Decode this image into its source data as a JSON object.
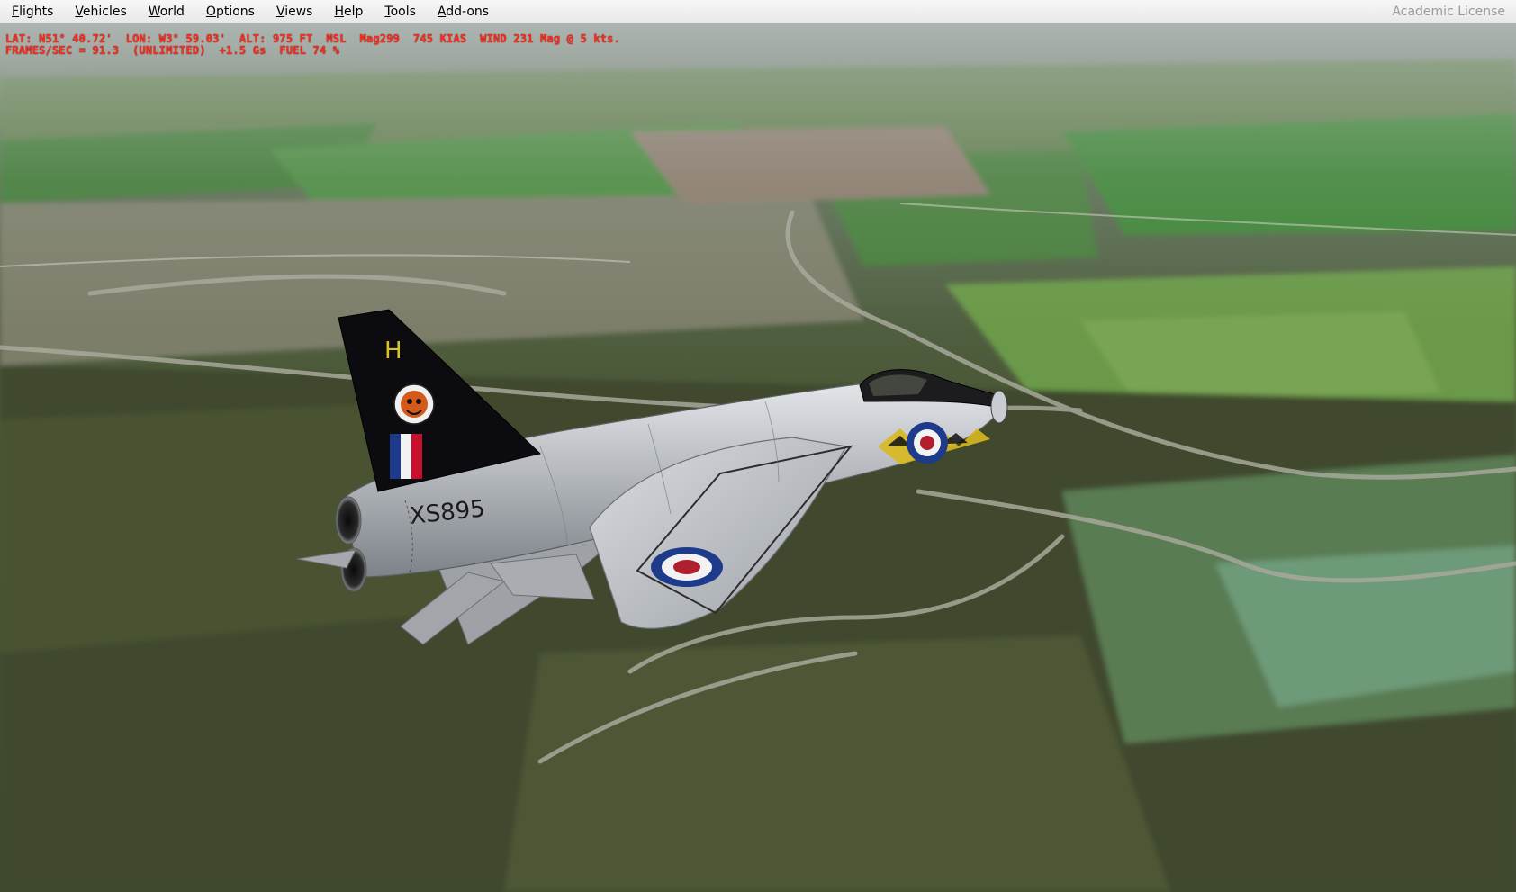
{
  "menubar": {
    "items": [
      {
        "mnemonic": "F",
        "rest": "lights"
      },
      {
        "mnemonic": "V",
        "rest": "ehicles"
      },
      {
        "mnemonic": "W",
        "rest": "orld"
      },
      {
        "mnemonic": "O",
        "rest": "ptions"
      },
      {
        "mnemonic": "V",
        "rest": "iews"
      },
      {
        "mnemonic": "H",
        "rest": "elp"
      },
      {
        "mnemonic": "T",
        "rest": "ools"
      },
      {
        "mnemonic": "A",
        "rest": "dd-ons"
      }
    ],
    "license": "Academic License"
  },
  "hud": {
    "line1": "LAT: N51° 40.72'  LON: W3° 59.03'  ALT: 975 FT  MSL  Mag299  745 KIAS  WIND 231 Mag @ 5 kts.",
    "line2": "FRAMES/SEC = 91.3  (UNLIMITED)  +1.5 Gs  FUEL 74 %",
    "color": "#ff2a1a"
  },
  "aircraft": {
    "serial": "XS895",
    "tail_code": "H",
    "finish_color": "#b9bcc0",
    "fin_color": "#0b0b0e"
  }
}
